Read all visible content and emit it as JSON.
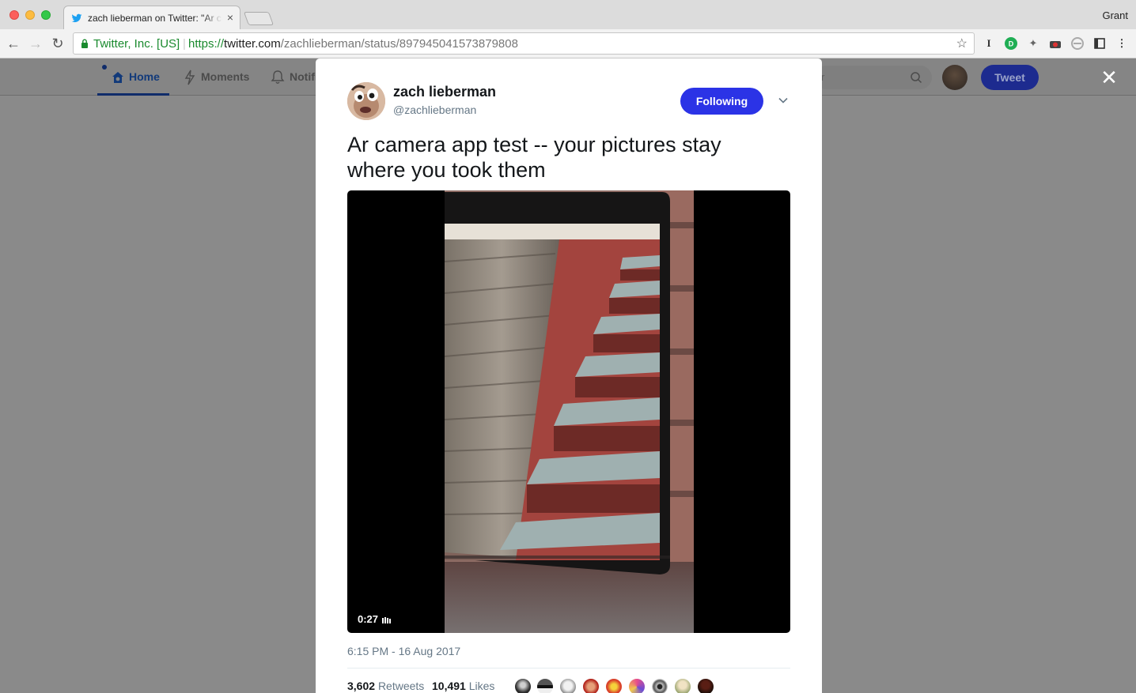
{
  "browser": {
    "tab_title": "zach lieberman on Twitter: \"Ar camera app test -- your pictures stay where you took them\"",
    "tab_close": "×",
    "profile_name": "Grant",
    "site_identity": "Twitter, Inc. [US]",
    "url_scheme": "https://",
    "url_host": "twitter.com",
    "url_path": "/zachlieberman/status/897945041573879808",
    "extensions": [
      "I",
      "ID",
      "pin",
      "camera",
      "vpn",
      "window",
      "more"
    ]
  },
  "twitter_nav": {
    "home": "Home",
    "moments": "Moments",
    "notifications": "Notifi",
    "search_fragment": "r",
    "tweet_button": "Tweet",
    "close_glyph": "✕"
  },
  "tweet": {
    "author_name": "zach lieberman",
    "author_handle": "@zachlieberman",
    "follow_label": "Following",
    "text": "Ar camera app test -- your pictures stay where you took them",
    "video_time": "0:27",
    "timestamp": "6:15 PM - 16 Aug 2017",
    "retweets_count": "3,602",
    "retweets_label": "Retweets",
    "likes_count": "10,491",
    "likes_label": "Likes"
  },
  "colors": {
    "accent": "#2b33e6",
    "muted": "#657786",
    "omnibox_secure": "#1a8a2e"
  }
}
